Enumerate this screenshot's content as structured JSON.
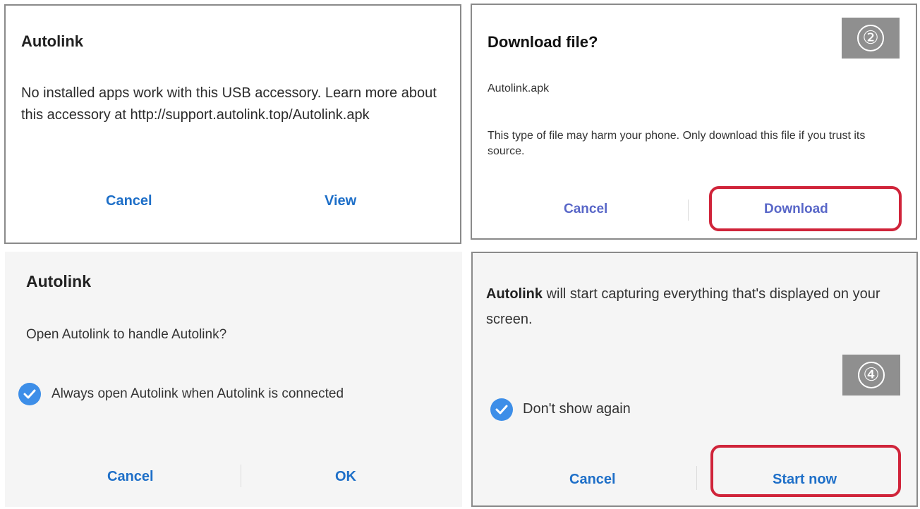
{
  "panel1": {
    "title": "Autolink",
    "message": "No installed apps work with this USB accessory. Learn more about this accessory at http://support.autolink.top/Autolink.apk",
    "cancel_label": "Cancel",
    "view_label": "View"
  },
  "panel2": {
    "title": "Download file?",
    "filename": "Autolink.apk",
    "warning": "This type of file may harm your phone. Only download this file if you trust its source.",
    "cancel_label": "Cancel",
    "download_label": "Download",
    "step_badge": "②"
  },
  "panel3": {
    "title": "Autolink",
    "question": "Open Autolink to handle Autolink?",
    "checkbox_label": "Always open Autolink when Autolink is connected",
    "checkbox_checked": true,
    "cancel_label": "Cancel",
    "ok_label": "OK"
  },
  "panel4": {
    "message_app": "Autolink",
    "message_rest": " will start capturing everything that's displayed on your screen.",
    "checkbox_label": "Don't show again",
    "checkbox_checked": true,
    "cancel_label": "Cancel",
    "start_label": "Start now",
    "step_badge": "④"
  },
  "colors": {
    "accent_blue": "#1e6fc8",
    "checkbox_blue": "#3d8ee8",
    "highlight_red": "#d0243a",
    "badge_gray": "#8f8f8f"
  }
}
